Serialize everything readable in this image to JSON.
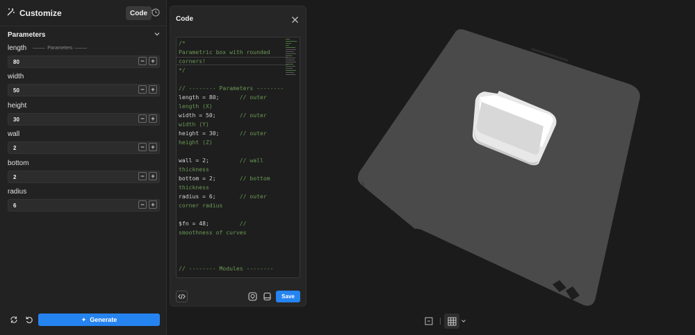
{
  "left_panel": {
    "title": "Customize",
    "code_button": "Code",
    "parameters_heading": "Parameters",
    "parameters_sublabel": "Parameters",
    "params": [
      {
        "label": "length",
        "value": "80"
      },
      {
        "label": "width",
        "value": "50"
      },
      {
        "label": "height",
        "value": "30"
      },
      {
        "label": "wall",
        "value": "2"
      },
      {
        "label": "bottom",
        "value": "2"
      },
      {
        "label": "radius",
        "value": "6"
      }
    ],
    "generate_label": "Generate"
  },
  "code_panel": {
    "title": "Code",
    "save_label": "Save",
    "lines": [
      {
        "t": "/*",
        "c": "com"
      },
      {
        "t": "Parametric box with rounded",
        "c": "com"
      },
      {
        "t": "corners!",
        "c": "com"
      },
      {
        "t": "*/",
        "c": "com"
      },
      {
        "t": "",
        "c": "def"
      },
      {
        "t": "// -------- Parameters --------",
        "c": "com"
      },
      {
        "t": "length = 80;      // outer",
        "c": "mix",
        "code": "length = 80;      ",
        "com": "// outer"
      },
      {
        "t": "length (X)",
        "c": "com"
      },
      {
        "t": "width = 50;       // outer",
        "c": "mix",
        "code": "width = 50;       ",
        "com": "// outer"
      },
      {
        "t": "width (Y)",
        "c": "com"
      },
      {
        "t": "height = 30;      // outer",
        "c": "mix",
        "code": "height = 30;      ",
        "com": "// outer"
      },
      {
        "t": "height (Z)",
        "c": "com"
      },
      {
        "t": "",
        "c": "def"
      },
      {
        "t": "wall = 2;         // wall",
        "c": "mix",
        "code": "wall = 2;         ",
        "com": "// wall"
      },
      {
        "t": "thickness",
        "c": "com"
      },
      {
        "t": "bottom = 2;       // bottom",
        "c": "mix",
        "code": "bottom = 2;       ",
        "com": "// bottom"
      },
      {
        "t": "thickness",
        "c": "com"
      },
      {
        "t": "radius = 6;       // outer",
        "c": "mix",
        "code": "radius = 6;       ",
        "com": "// outer"
      },
      {
        "t": "corner radius",
        "c": "com"
      },
      {
        "t": "",
        "c": "def"
      },
      {
        "t": "$fn = 48;         //",
        "c": "mix",
        "code": "$fn = 48;         ",
        "com": "//"
      },
      {
        "t": "smoothness of curves",
        "c": "com"
      },
      {
        "t": "",
        "c": "def"
      },
      {
        "t": "",
        "c": "def"
      },
      {
        "t": "",
        "c": "def"
      },
      {
        "t": "// -------- Modules --------",
        "c": "com"
      }
    ]
  },
  "viewport": {
    "plate_color": "#4a4a4a",
    "model_color": "#ffffff"
  },
  "colors": {
    "accent": "#2684f0",
    "comment": "#6a9955"
  }
}
